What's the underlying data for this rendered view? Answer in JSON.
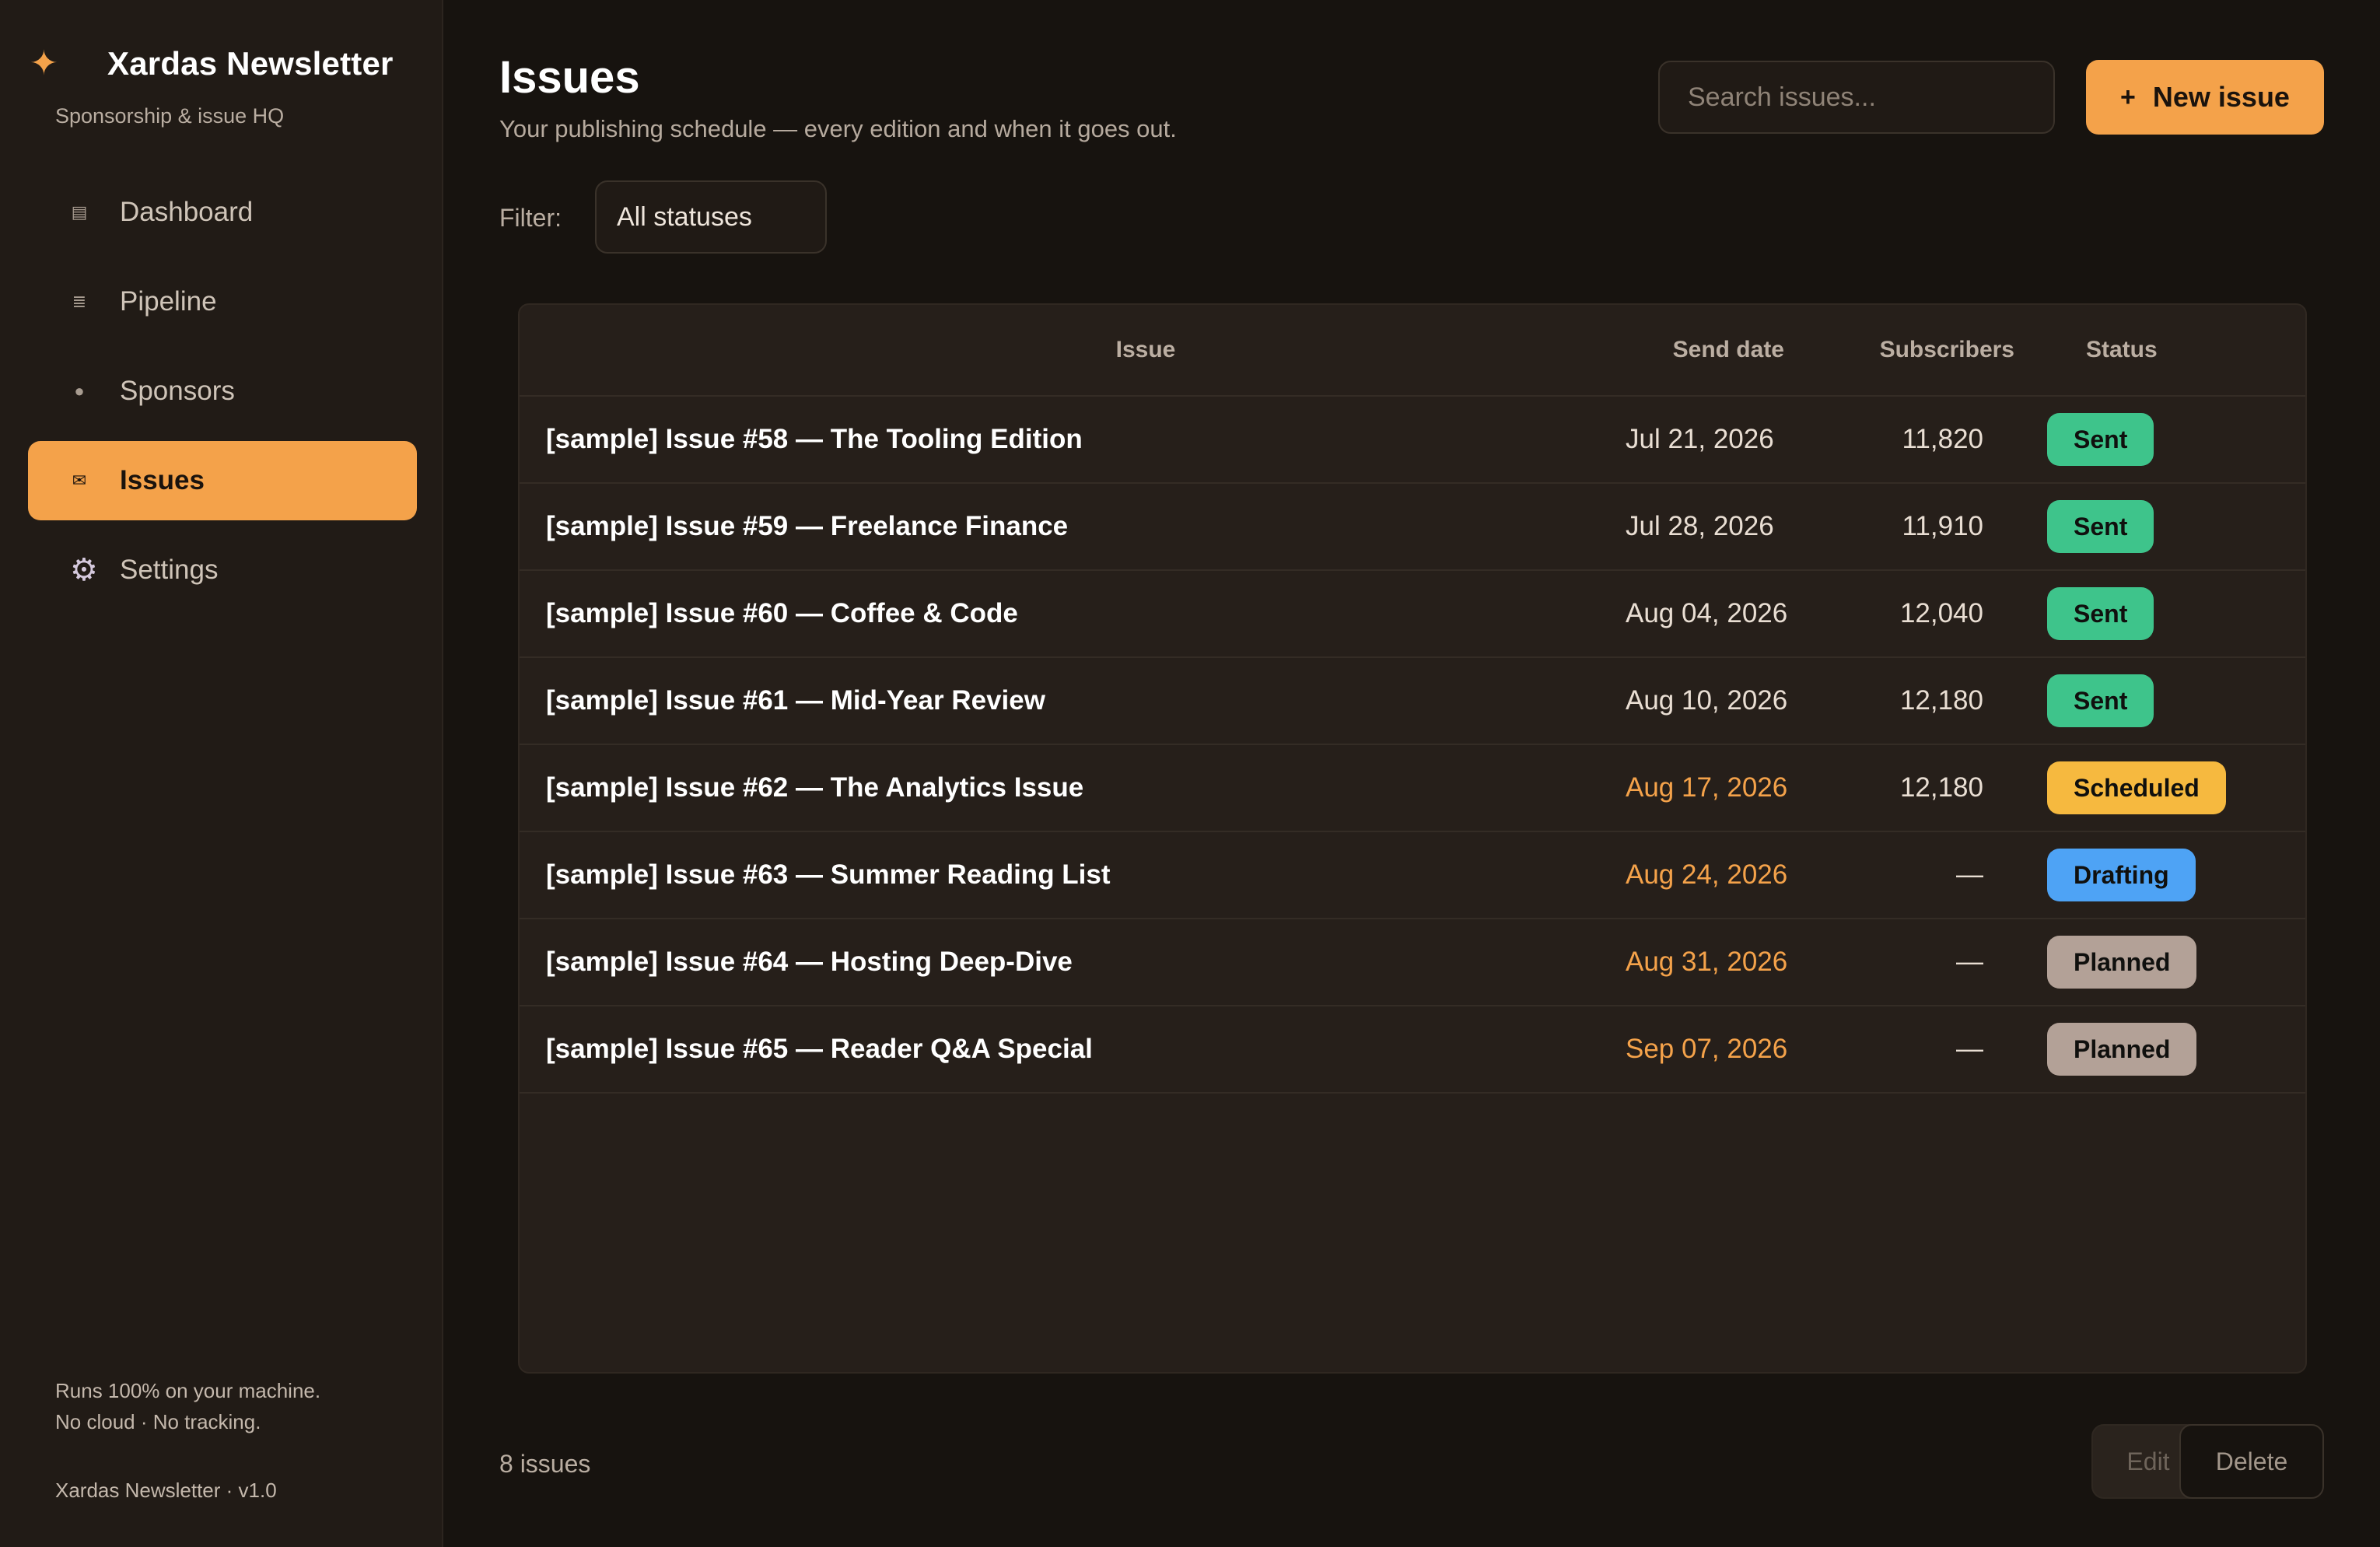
{
  "sidebar": {
    "brand_icon": "✦",
    "brand_title": "Xardas Newsletter",
    "brand_subtitle": "Sponsorship & issue HQ",
    "items": [
      {
        "label": "Dashboard",
        "icon": "dashboard-icon",
        "glyph": "▤",
        "active": false
      },
      {
        "label": "Pipeline",
        "icon": "pipeline-icon",
        "glyph": "≣",
        "active": false
      },
      {
        "label": "Sponsors",
        "icon": "sponsors-icon",
        "glyph": "●",
        "active": false
      },
      {
        "label": "Issues",
        "icon": "mail-icon",
        "glyph": "✉",
        "active": true
      },
      {
        "label": "Settings",
        "icon": "gear-icon",
        "glyph": "⚙",
        "active": false
      }
    ],
    "footer_line1": "Runs 100% on your machine.",
    "footer_line2": "No cloud · No tracking.",
    "version": "Xardas Newsletter · v1.0"
  },
  "header": {
    "title": "Issues",
    "subtitle": "Your publishing schedule — every edition and when it goes out.",
    "search_placeholder": "Search issues...",
    "new_button_plus": "+",
    "new_button_label": "New issue"
  },
  "filter": {
    "label": "Filter:",
    "selected": "All statuses"
  },
  "table": {
    "columns": [
      "Issue",
      "Send date",
      "Subscribers",
      "Status"
    ],
    "rows": [
      {
        "issue": "[sample] Issue #58 — The Tooling Edition",
        "date": "Jul 21, 2026",
        "subscribers": "11,820",
        "status": "Sent",
        "upcoming": false
      },
      {
        "issue": "[sample] Issue #59 — Freelance Finance",
        "date": "Jul 28, 2026",
        "subscribers": "11,910",
        "status": "Sent",
        "upcoming": false
      },
      {
        "issue": "[sample] Issue #60 — Coffee & Code",
        "date": "Aug 04, 2026",
        "subscribers": "12,040",
        "status": "Sent",
        "upcoming": false
      },
      {
        "issue": "[sample] Issue #61 — Mid-Year Review",
        "date": "Aug 10, 2026",
        "subscribers": "12,180",
        "status": "Sent",
        "upcoming": false
      },
      {
        "issue": "[sample] Issue #62 — The Analytics Issue",
        "date": "Aug 17, 2026",
        "subscribers": "12,180",
        "status": "Scheduled",
        "upcoming": true
      },
      {
        "issue": "[sample] Issue #63 — Summer Reading List",
        "date": "Aug 24, 2026",
        "subscribers": "—",
        "status": "Drafting",
        "upcoming": true
      },
      {
        "issue": "[sample] Issue #64 — Hosting Deep-Dive",
        "date": "Aug 31, 2026",
        "subscribers": "—",
        "status": "Planned",
        "upcoming": true
      },
      {
        "issue": "[sample] Issue #65 — Reader Q&A Special",
        "date": "Sep 07, 2026",
        "subscribers": "—",
        "status": "Planned",
        "upcoming": true
      }
    ]
  },
  "footer": {
    "count": "8 issues",
    "edit_label": "Edit",
    "delete_label": "Delete"
  },
  "colors": {
    "accent": "#f4a24a",
    "background": "#17130f",
    "sidebar": "#211b16",
    "status_sent": "#3ec48b",
    "status_scheduled": "#f6b93f",
    "status_drafting": "#4ea3f5",
    "status_planned": "#b3a197"
  }
}
